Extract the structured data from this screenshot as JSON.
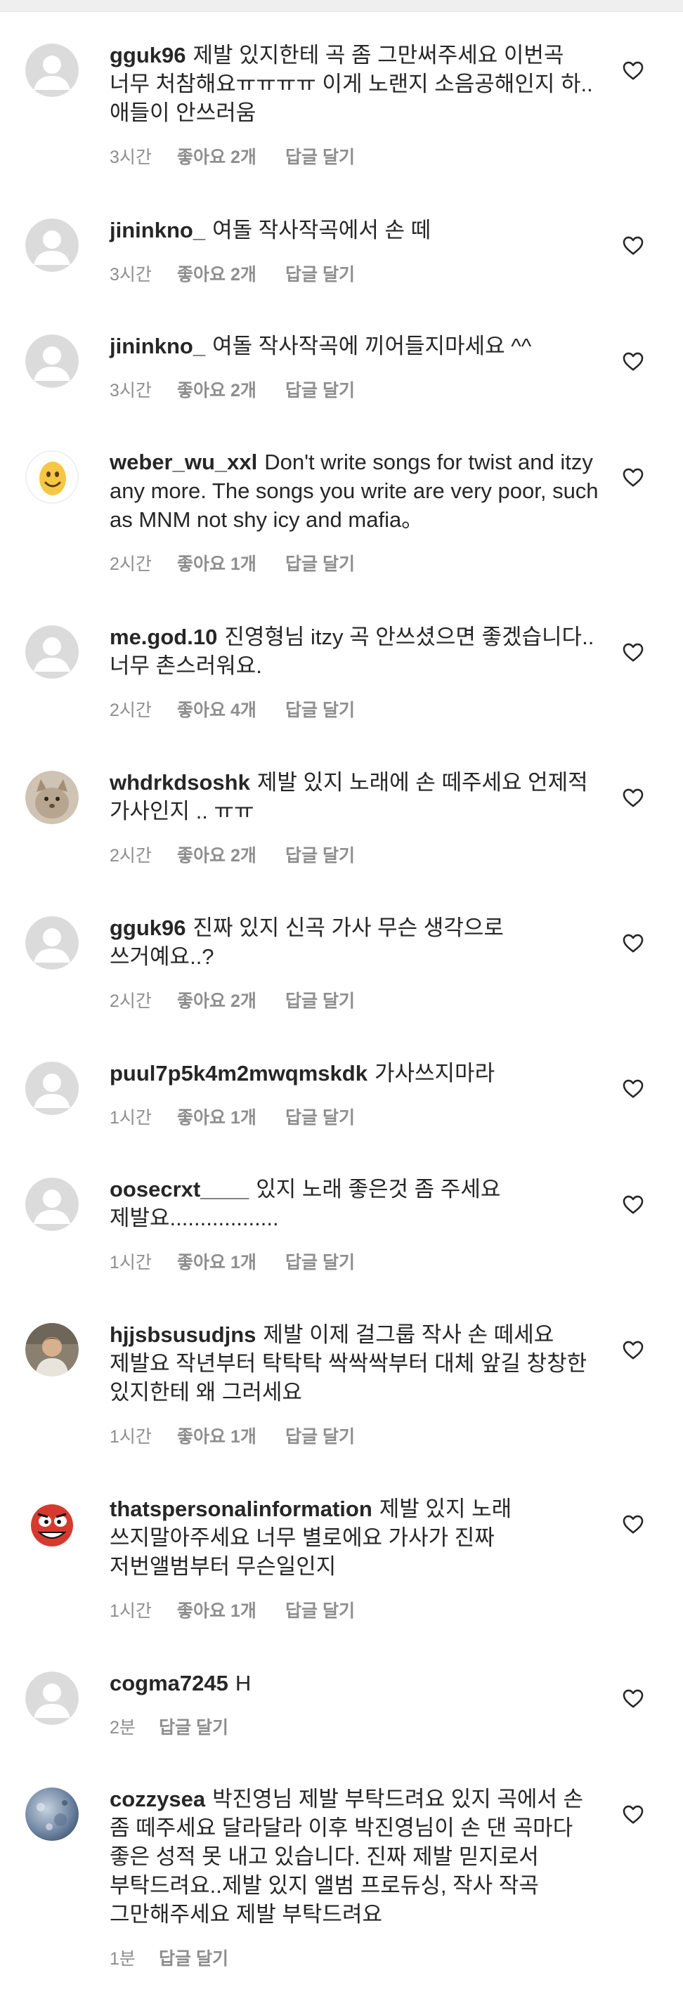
{
  "comments": [
    {
      "username": "gguk96",
      "text": "제발 있지한테 곡 좀 그만써주세요 이번곡 너무 처참해요ㅠㅠㅠㅠ 이게 노랜지 소음공해인지 하.. 애들이 안쓰러움",
      "time": "3시간",
      "likes": "좋아요 2개",
      "reply": "답글 달기",
      "avatar": "default-avatar"
    },
    {
      "username": "jininkno_",
      "text": "여돌 작사작곡에서 손 떼",
      "time": "3시간",
      "likes": "좋아요 2개",
      "reply": "답글 달기",
      "avatar": "default-avatar"
    },
    {
      "username": "jininkno_",
      "text": "여돌 작사작곡에 끼어들지마세요 ^^",
      "time": "3시간",
      "likes": "좋아요 2개",
      "reply": "답글 달기",
      "avatar": "default-avatar"
    },
    {
      "username": "weber_wu_xxl",
      "text": "Don't write songs for twist and itzy any more. The songs you write are very poor, such as MNM not shy icy and mafia。",
      "time": "2시간",
      "likes": "좋아요 1개",
      "reply": "답글 달기",
      "avatar": "smiley-emoji-avatar"
    },
    {
      "username": "me.god.10",
      "text": "진영형님 itzy 곡 안쓰셨으면 좋겠습니다.. 너무 촌스러워요.",
      "time": "2시간",
      "likes": "좋아요 4개",
      "reply": "답글 달기",
      "avatar": "default-avatar"
    },
    {
      "username": "whdrkdsoshk",
      "text": "제발 있지 노래에 손 떼주세요 언제적 가사인지 .. ㅠㅠ",
      "time": "2시간",
      "likes": "좋아요 2개",
      "reply": "답글 달기",
      "avatar": "cat-photo-avatar"
    },
    {
      "username": "gguk96",
      "text": "진짜 있지 신곡 가사 무슨 생각으로 쓰거예요..?",
      "time": "2시간",
      "likes": "좋아요 2개",
      "reply": "답글 달기",
      "avatar": "default-avatar"
    },
    {
      "username": "puul7p5k4m2mwqmskdk",
      "text": "가사쓰지마라",
      "time": "1시간",
      "likes": "좋아요 1개",
      "reply": "답글 달기",
      "avatar": "default-avatar"
    },
    {
      "username": "oosecrxt____",
      "text": "있지 노래 좋은것 좀 주세요 제발요..................",
      "time": "1시간",
      "likes": "좋아요 1개",
      "reply": "답글 달기",
      "avatar": "default-avatar"
    },
    {
      "username": "hjjsbsusudjns",
      "text": "제발 이제 걸그룹 작사 손 떼세요 제발요 작년부터 탁탁탁 싹싹싹부터 대체 앞길 창창한 있지한테 왜 그러세요",
      "time": "1시간",
      "likes": "좋아요 1개",
      "reply": "답글 달기",
      "avatar": "person-photo-avatar"
    },
    {
      "username": "thatspersonalinformation",
      "text": "제발 있지 노래 쓰지말아주세요 너무 별로에요 가사가 진짜 저번앨범부터 무슨일인지",
      "time": "1시간",
      "likes": "좋아요 1개",
      "reply": "답글 달기",
      "avatar": "red-cartoon-avatar"
    },
    {
      "username": "cogma7245",
      "text": "H",
      "time": "2분",
      "likes": "",
      "reply": "답글 달기",
      "avatar": "default-avatar"
    },
    {
      "username": "cozzysea",
      "text": "박진영님 제발 부탁드려요 있지 곡에서 손 좀 떼주세요 달라달라 이후 박진영님이 손 댄 곡마다 좋은 성적 못 내고 있습니다. 진짜 제발 믿지로서 부탁드려요..제발 있지 앨범 프로듀싱, 작사 작곡 그만해주세요 제발 부탁드려요",
      "time": "1분",
      "likes": "",
      "reply": "답글 달기",
      "avatar": "blue-texture-avatar"
    }
  ],
  "icons": {
    "like": "heart-outline-icon",
    "default_avatar": "person-silhouette-icon"
  },
  "colors": {
    "text": "#262626",
    "meta": "#8e8e8e",
    "avatar_bg": "#dbdbdb"
  }
}
